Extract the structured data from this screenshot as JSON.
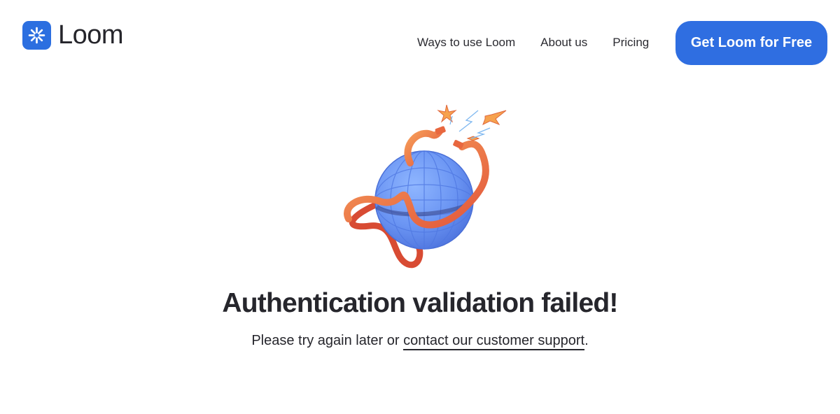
{
  "header": {
    "logo_text": "Loom",
    "logo_icon": "loom-asterisk-icon",
    "nav": [
      {
        "label": "Ways to use Loom"
      },
      {
        "label": "About us"
      },
      {
        "label": "Pricing"
      }
    ],
    "cta_label": "Get Loom for Free"
  },
  "main": {
    "illustration_icon": "broken-globe-cable-illustration",
    "title": "Authentication validation failed!",
    "message_prefix": "Please try again later or ",
    "support_link_label": "contact our customer support",
    "message_suffix": "."
  },
  "colors": {
    "brand_blue": "#2f6ee1",
    "text": "#26262c",
    "globe_blue": "#6f9bf6",
    "cable_orange": "#f07a4a"
  }
}
